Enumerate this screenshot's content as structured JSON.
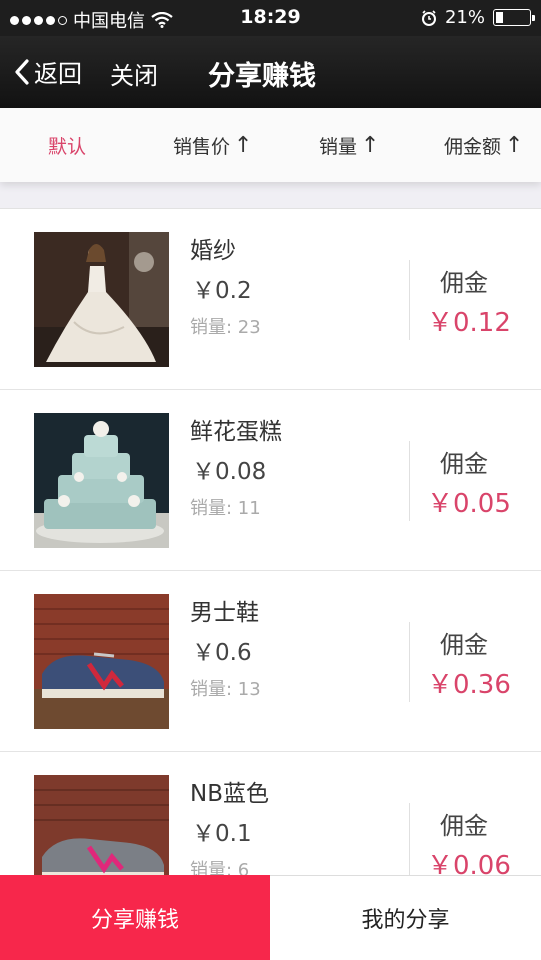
{
  "status": {
    "carrier": "中国电信",
    "time": "18:29",
    "battery": "21%"
  },
  "nav": {
    "back": "返回",
    "close": "关闭",
    "title": "分享赚钱"
  },
  "sort": [
    "默认",
    "销售价",
    "销量",
    "佣金额"
  ],
  "commission_label": "佣金",
  "products": [
    {
      "name": "婚纱",
      "price": "￥0.2",
      "sales": "销量: 23",
      "commission": "￥0.12"
    },
    {
      "name": "鲜花蛋糕",
      "price": "￥0.08",
      "sales": "销量: 11",
      "commission": "￥0.05"
    },
    {
      "name": "男士鞋",
      "price": "￥0.6",
      "sales": "销量: 13",
      "commission": "￥0.36"
    },
    {
      "name": "NB蓝色",
      "price": "￥0.1",
      "sales": "销量: 6",
      "commission": "￥0.06"
    }
  ],
  "bottom": {
    "share": "分享赚钱",
    "my_share": "我的分享"
  },
  "colors": {
    "accent": "#d9446a",
    "share_button": "#f7274b"
  }
}
